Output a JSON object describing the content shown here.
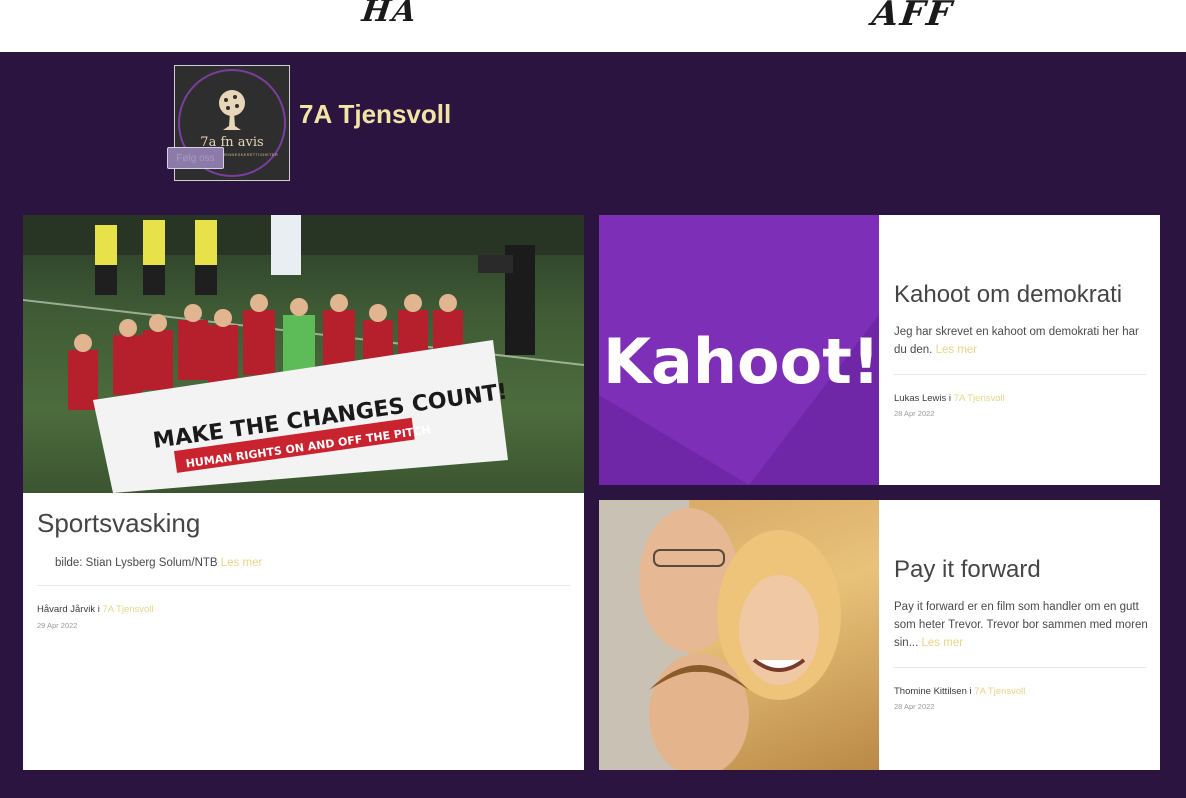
{
  "banner": {
    "ink_left": "HA",
    "ink_right": "AFF"
  },
  "header": {
    "logo_text": "7a fn avis",
    "logo_sub": "DEMOKRATI OG MENNESKERETTIGHETER",
    "site_title": "7A Tjensvoll",
    "follow_label": "Følg oss"
  },
  "posts": [
    {
      "title": "Sportsvasking",
      "excerpt": "bilde: Stian Lysberg Solum/NTB",
      "read_more": "Les mer",
      "author": "Håvard Jårvik",
      "in": "i",
      "category": "7A Tjensvoll",
      "date": "29 Apr 2022",
      "image": {
        "banner_line1": "MAKE THE CHANGES COUNT!",
        "banner_line2": "HUMAN RIGHTS ON AND OFF THE PITCH"
      }
    },
    {
      "title": "Kahoot om demokrati",
      "excerpt": "Jeg har skrevet en kahoot om demokrati her har du den.",
      "read_more": "Les mer",
      "author": "Lukas Lewis",
      "in": "i",
      "category": "7A Tjensvoll",
      "date": "28 Apr 2022",
      "image": {
        "logo_word": "Kahoot!"
      }
    },
    {
      "title": "Pay it forward",
      "excerpt": "Pay it forward er en film som handler om en gutt som heter Trevor. Trevor bor sammen med moren sin...",
      "read_more": "Les mer",
      "author": "Thomine Kittilsen",
      "in": "i",
      "category": "7A Tjensvoll",
      "date": "28 Apr 2022"
    }
  ]
}
